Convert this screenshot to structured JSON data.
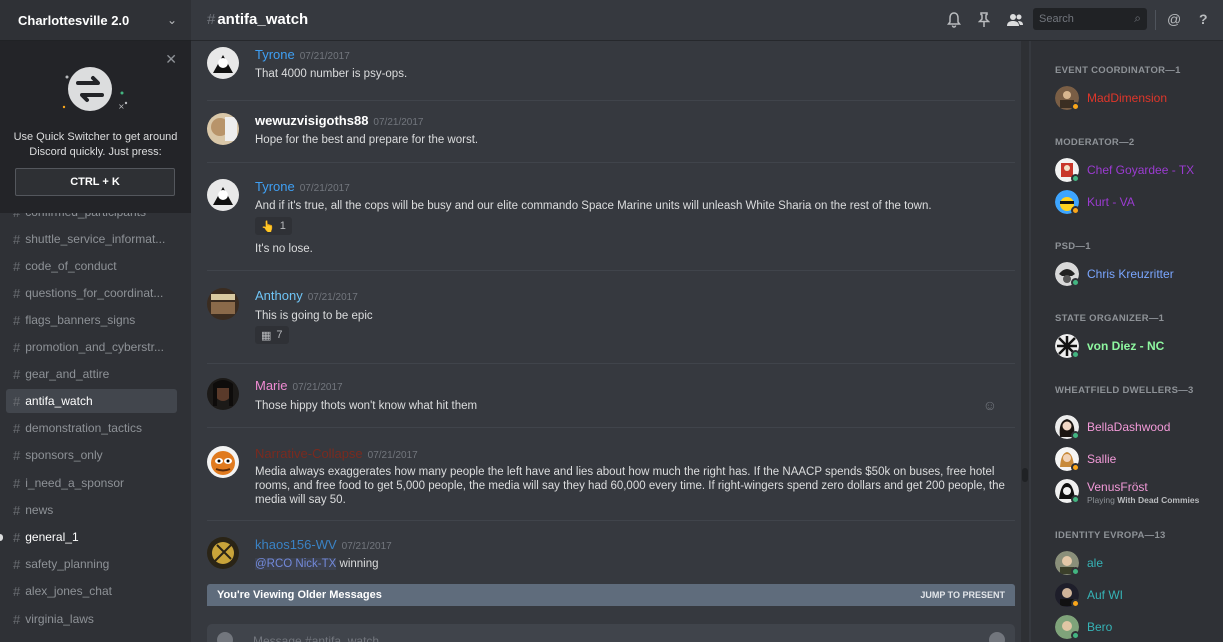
{
  "guild": {
    "name": "Charlottesville 2.0"
  },
  "quick_switcher": {
    "text": "Use Quick Switcher to get around Discord quickly. Just press:",
    "shortcut": "CTRL + K"
  },
  "channels": [
    {
      "name": "confirmed_participants",
      "state": "normal"
    },
    {
      "name": "shuttle_service_informat...",
      "state": "normal"
    },
    {
      "name": "code_of_conduct",
      "state": "normal"
    },
    {
      "name": "questions_for_coordinat...",
      "state": "normal"
    },
    {
      "name": "flags_banners_signs",
      "state": "normal"
    },
    {
      "name": "promotion_and_cyberstr...",
      "state": "normal"
    },
    {
      "name": "gear_and_attire",
      "state": "normal"
    },
    {
      "name": "antifa_watch",
      "state": "active"
    },
    {
      "name": "demonstration_tactics",
      "state": "normal"
    },
    {
      "name": "sponsors_only",
      "state": "normal"
    },
    {
      "name": "i_need_a_sponsor",
      "state": "normal"
    },
    {
      "name": "news",
      "state": "normal"
    },
    {
      "name": "general_1",
      "state": "unread"
    },
    {
      "name": "safety_planning",
      "state": "normal"
    },
    {
      "name": "alex_jones_chat",
      "state": "normal"
    },
    {
      "name": "virginia_laws",
      "state": "normal"
    }
  ],
  "header": {
    "channel": "antifa_watch",
    "search_placeholder": "Search"
  },
  "messages": [
    {
      "author": "Tyrone",
      "color": "#3f9ff3",
      "time": "07/21/2017",
      "lines": [
        "That 4000 number is psy-ops."
      ]
    },
    {
      "author": "wewuzvisigoths88",
      "color": "#ffffff",
      "time": "07/21/2017",
      "lines": [
        "Hope for the best and prepare for the worst."
      ]
    },
    {
      "author": "Tyrone",
      "color": "#3f9ff3",
      "time": "07/21/2017",
      "lines": [
        "And if it's true, all the cops will be busy and our elite commando Space Marine units will unleash White Sharia on the rest of the town.",
        "It's no lose."
      ],
      "reaction": {
        "emoji": "👆",
        "count": "1"
      }
    },
    {
      "author": "Anthony",
      "color": "#6fc4f5",
      "time": "07/21/2017",
      "lines": [
        "This is going to be epic"
      ],
      "reaction": {
        "emoji": "▦",
        "count": "7"
      }
    },
    {
      "author": "Marie",
      "color": "#f08bd3",
      "time": "07/21/2017",
      "lines": [
        "Those hippy thots won't know what hit them"
      ]
    },
    {
      "author": "Narrative-Collapse",
      "color": "#7a2a1f",
      "time": "07/21/2017",
      "lines": [
        "Media always exaggerates how many people the left have and lies about how much the right has. If the NAACP spends $50k on buses, free hotel rooms, and free food to get 5,000 people, the media will say they had 60,000 every time. If right-wingers spend zero dollars and get 200 people, the media will say 50."
      ]
    },
    {
      "author": "khaos156-WV",
      "color": "#3a82c4",
      "time": "07/21/2017",
      "mention": "@RCO Nick-TX",
      "lines": [
        "winning"
      ]
    }
  ],
  "older_bar": {
    "text": "You're Viewing Older Messages",
    "jump": "JUMP TO PRESENT"
  },
  "composer": {
    "placeholder": "Message #antifa_watch"
  },
  "member_groups": [
    {
      "role": "EVENT COORDINATOR—1",
      "members": [
        {
          "name": "MadDimension",
          "color": "#e0362a",
          "status": "#faa61a"
        }
      ]
    },
    {
      "role": "MODERATOR—2",
      "members": [
        {
          "name": "Chef Goyardee - TX",
          "color": "#9b3bd1",
          "status": "#43b581"
        },
        {
          "name": "Kurt - VA",
          "color": "#9b3bd1",
          "status": "#faa61a"
        }
      ]
    },
    {
      "role": "PSD—1",
      "members": [
        {
          "name": "Chris Kreuzritter",
          "color": "#7aa6ff",
          "status": "#43b581"
        }
      ]
    },
    {
      "role": "STATE ORGANIZER—1",
      "members": [
        {
          "name": "von Diez - NC",
          "color": "#8ef7a0",
          "status": "#43b581"
        }
      ]
    },
    {
      "role": "WHEATFIELD DWELLERS—3",
      "members": [
        {
          "name": "BellaDashwood",
          "color": "#f29ad8",
          "status": "#43b581"
        },
        {
          "name": "Sallie",
          "color": "#f29ad8",
          "status": "#faa61a"
        },
        {
          "name": "VenusFröst",
          "color": "#f29ad8",
          "status": "#43b581",
          "activity_prefix": "Playing",
          "activity": "With Dead Commies"
        }
      ]
    },
    {
      "role": "IDENTITY EVROPA—13",
      "members": [
        {
          "name": "ale",
          "color": "#36b3b6",
          "status": "#43b581"
        },
        {
          "name": "Auf WI",
          "color": "#36b3b6",
          "status": "#faa61a"
        },
        {
          "name": "Bero",
          "color": "#36b3b6",
          "status": "#43b581"
        }
      ]
    }
  ]
}
